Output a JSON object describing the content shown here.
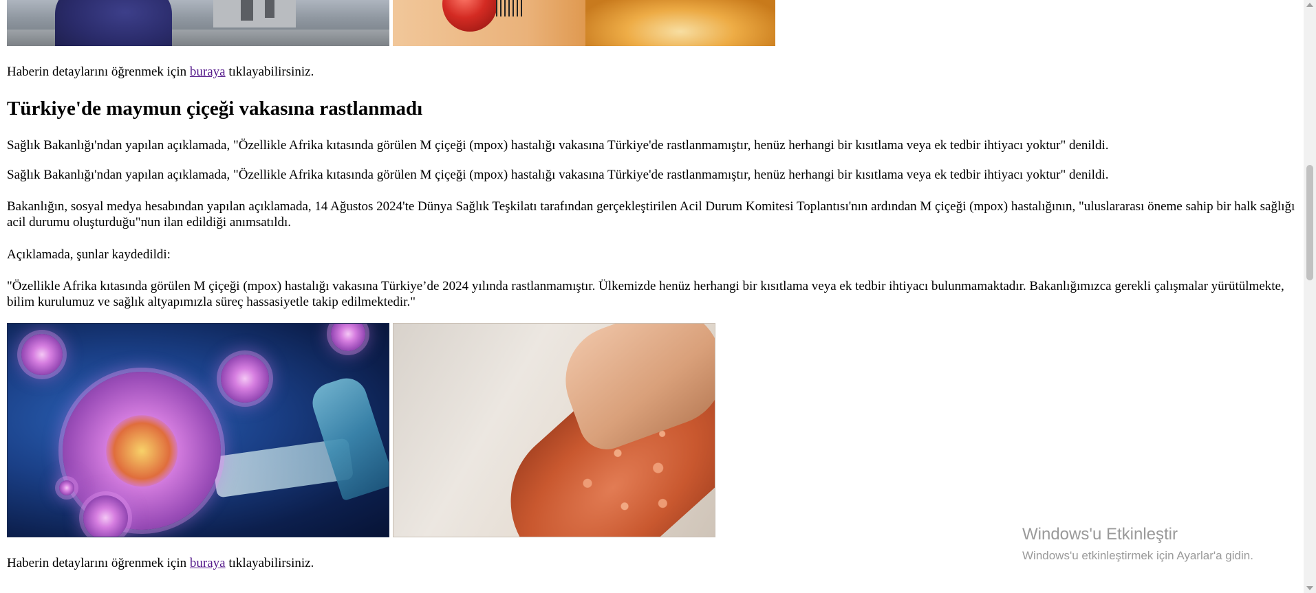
{
  "article": {
    "detail_text_before": "Haberin detaylarını öğrenmek için",
    "link_text": "buraya",
    "detail_text_after": "tıklayabilirsiniz.",
    "heading": "Türkiye'de maymun çiçeği vakasına rastlanmadı",
    "paragraphs": [
      "Sağlık Bakanlığı'ndan yapılan açıklamada, \"Özellikle Afrika kıtasında görülen M çiçeği (mpox) hastalığı vakasına Türkiye'de rastlanmamıştır, henüz herhangi bir kısıtlama veya ek tedbir ihtiyacı yoktur\" denildi.",
      "Sağlık Bakanlığı'ndan yapılan açıklamada, \"Özellikle Afrika kıtasında görülen M çiçeği (mpox) hastalığı vakasına Türkiye'de rastlanmamıştır, henüz herhangi bir kısıtlama veya ek tedbir ihtiyacı yoktur\" denildi.",
      "Bakanlığın, sosyal medya hesabından yapılan açıklamada, 14 Ağustos 2024'te Dünya Sağlık Teşkilatı tarafından gerçekleştirilen Acil Durum Komitesi Toplantısı'nın ardından M çiçeği (mpox) hastalığının, \"uluslararası öneme sahip bir halk sağlığı acil durumu oluşturduğu\"nun ilan edildiği anımsatıldı.",
      "Açıklamada, şunlar kaydedildi:",
      "\"Özellikle Afrika kıtasında görülen M çiçeği (mpox) hastalığı vakasına Türkiye’de 2024 yılında rastlanmamıştır. Ülkemizde henüz herhangi bir kısıtlama veya ek tedbir ihtiyacı bulunmamaktadır. Bakanlığımızca gerekli çalışmalar yürütülmekte, bilim kurulumuz ve sağlık altyapımızla süreç hassasiyetle takip edilmektedir.\""
    ]
  },
  "watermark": {
    "title": "Windows'u Etkinleştir",
    "subtitle": "Windows'u etkinleştirmek için Ayarlar'a gidin."
  }
}
